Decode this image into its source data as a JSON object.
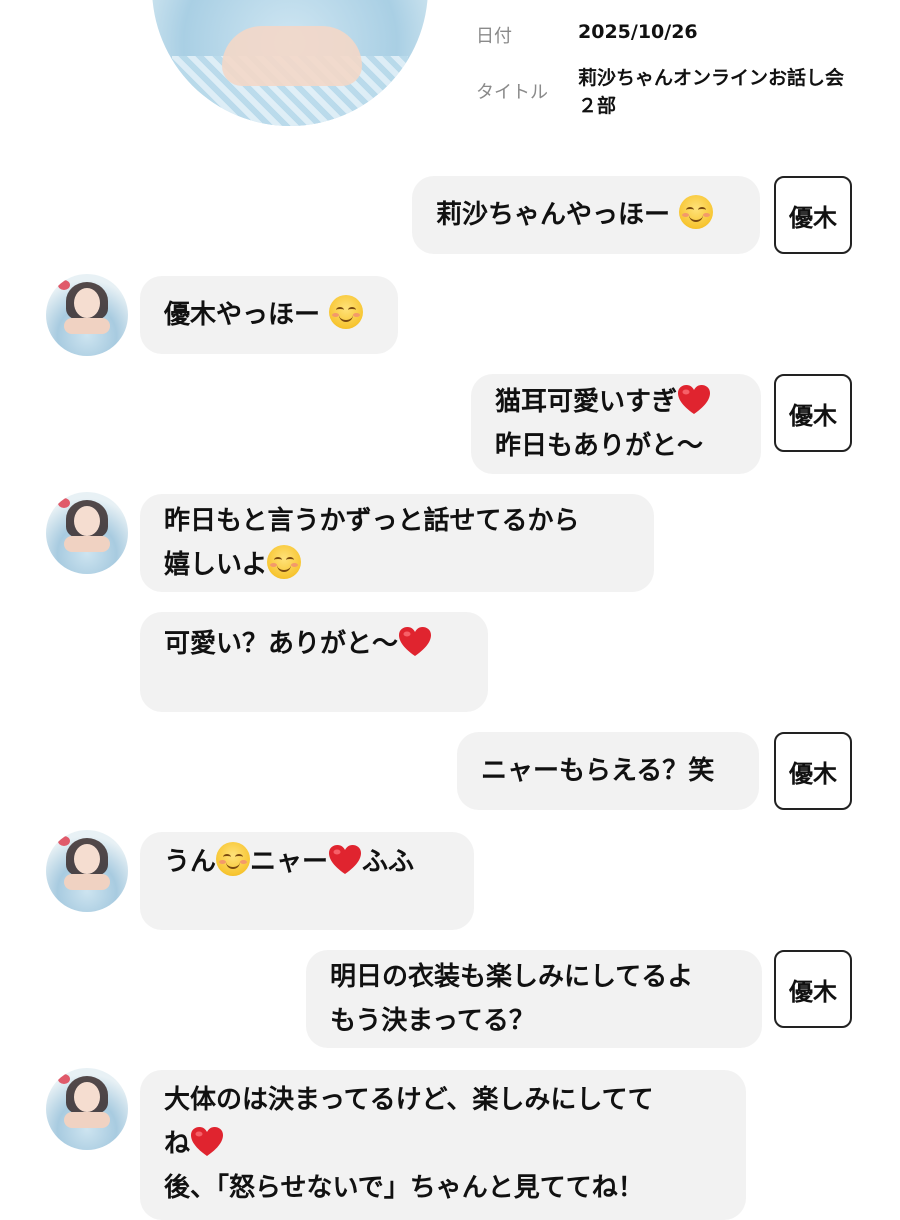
{
  "header": {
    "date_label": "日付",
    "date_value": "2025/10/26",
    "title_label": "タイトル",
    "title_line1": "莉沙ちゃんオンラインお話し会",
    "title_line2": "２部"
  },
  "messages": [
    {
      "from": "fan",
      "tag": "優木",
      "lines": [
        "莉沙ちゃんやっほー"
      ],
      "emoji": [
        "smile-icon"
      ]
    },
    {
      "from": "idol",
      "lines": [
        "優木やっほー"
      ],
      "emoji": [
        "smile-icon"
      ]
    },
    {
      "from": "fan",
      "tag": "優木",
      "lines": [
        "猫耳可愛いすぎ",
        "昨日もありがと〜"
      ],
      "emoji": [
        "heart-icon"
      ]
    },
    {
      "from": "idol",
      "lines": [
        "昨日もと言うかずっと話せてるから",
        "嬉しいよ"
      ],
      "emoji": [
        "smile-icon"
      ]
    },
    {
      "from": "idol",
      "lines": [
        "可愛い？ありがと〜"
      ],
      "emoji": [
        "heart-icon"
      ]
    },
    {
      "from": "fan",
      "tag": "優木",
      "lines": [
        "ニャーもらえる？笑"
      ]
    },
    {
      "from": "idol",
      "parts": [
        "うん",
        "ニャー",
        "ふふ"
      ],
      "emoji": [
        "smile-icon",
        "heart-icon"
      ]
    },
    {
      "from": "fan",
      "tag": "優木",
      "lines": [
        "明日の衣装も楽しみにしてるよ",
        "もう決まってる？"
      ]
    },
    {
      "from": "idol",
      "lines": [
        "大体のは決まってるけど、楽しみにしてて",
        "ね",
        "後、「怒らせないで」ちゃんと見ててね！"
      ],
      "emoji": [
        "heart-icon"
      ]
    }
  ],
  "colors": {
    "bubble_bg": "#f2f2f2",
    "heart": "#e0242f",
    "smile": "#f7c531"
  }
}
